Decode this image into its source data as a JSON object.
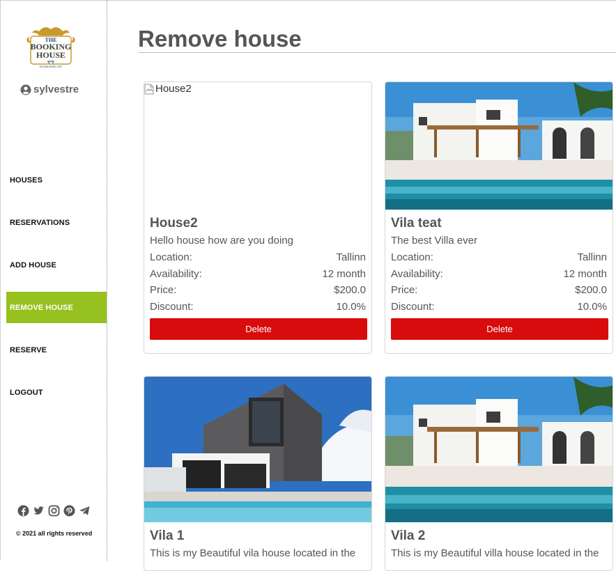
{
  "app": {
    "logo_text_1": "THE",
    "logo_text_2": "BOOKING",
    "logo_text_3": "HOUSE",
    "logo_tagline": "ESTABLISHED 1997",
    "username": "sylvestre"
  },
  "nav": {
    "items": [
      {
        "label": "HOUSES",
        "active": false
      },
      {
        "label": "RESERVATIONS",
        "active": false
      },
      {
        "label": "ADD HOUSE",
        "active": false
      },
      {
        "label": "REMOVE HOUSE",
        "active": true
      },
      {
        "label": "RESERVE",
        "active": false
      },
      {
        "label": "LOGOUT",
        "active": false
      }
    ]
  },
  "socials": [
    "facebook-icon",
    "twitter-icon",
    "instagram-icon",
    "pinterest-icon",
    "telegram-icon"
  ],
  "footer": {
    "copyright": "© 2021 all rights reserved"
  },
  "page": {
    "title": "Remove house"
  },
  "labels": {
    "location": "Location:",
    "availability": "Availability:",
    "price": "Price:",
    "discount": "Discount:",
    "delete": "Delete"
  },
  "houses": [
    {
      "name": "House2",
      "image_alt": "House2",
      "image_broken": true,
      "description": "Hello house how are you doing",
      "location": "Tallinn",
      "availability": "12 month",
      "price": "$200.0",
      "discount": "10.0%"
    },
    {
      "name": "Vila teat",
      "image_alt": "",
      "image_broken": false,
      "description": "The best Villa ever",
      "location": "Tallinn",
      "availability": "12 month",
      "price": "$200.0",
      "discount": "10.0%"
    },
    {
      "name": "Vila 1",
      "image_alt": "",
      "image_broken": false,
      "description": "This is my Beautiful vila house located in the"
    },
    {
      "name": "Vila 2",
      "image_alt": "",
      "image_broken": false,
      "description": "This is my Beautiful villa house located in the"
    }
  ],
  "colors": {
    "accent": "#96c11f",
    "danger": "#d80c0c",
    "logo_blue": "#1b3f7a",
    "logo_gold": "#c79a2e"
  }
}
